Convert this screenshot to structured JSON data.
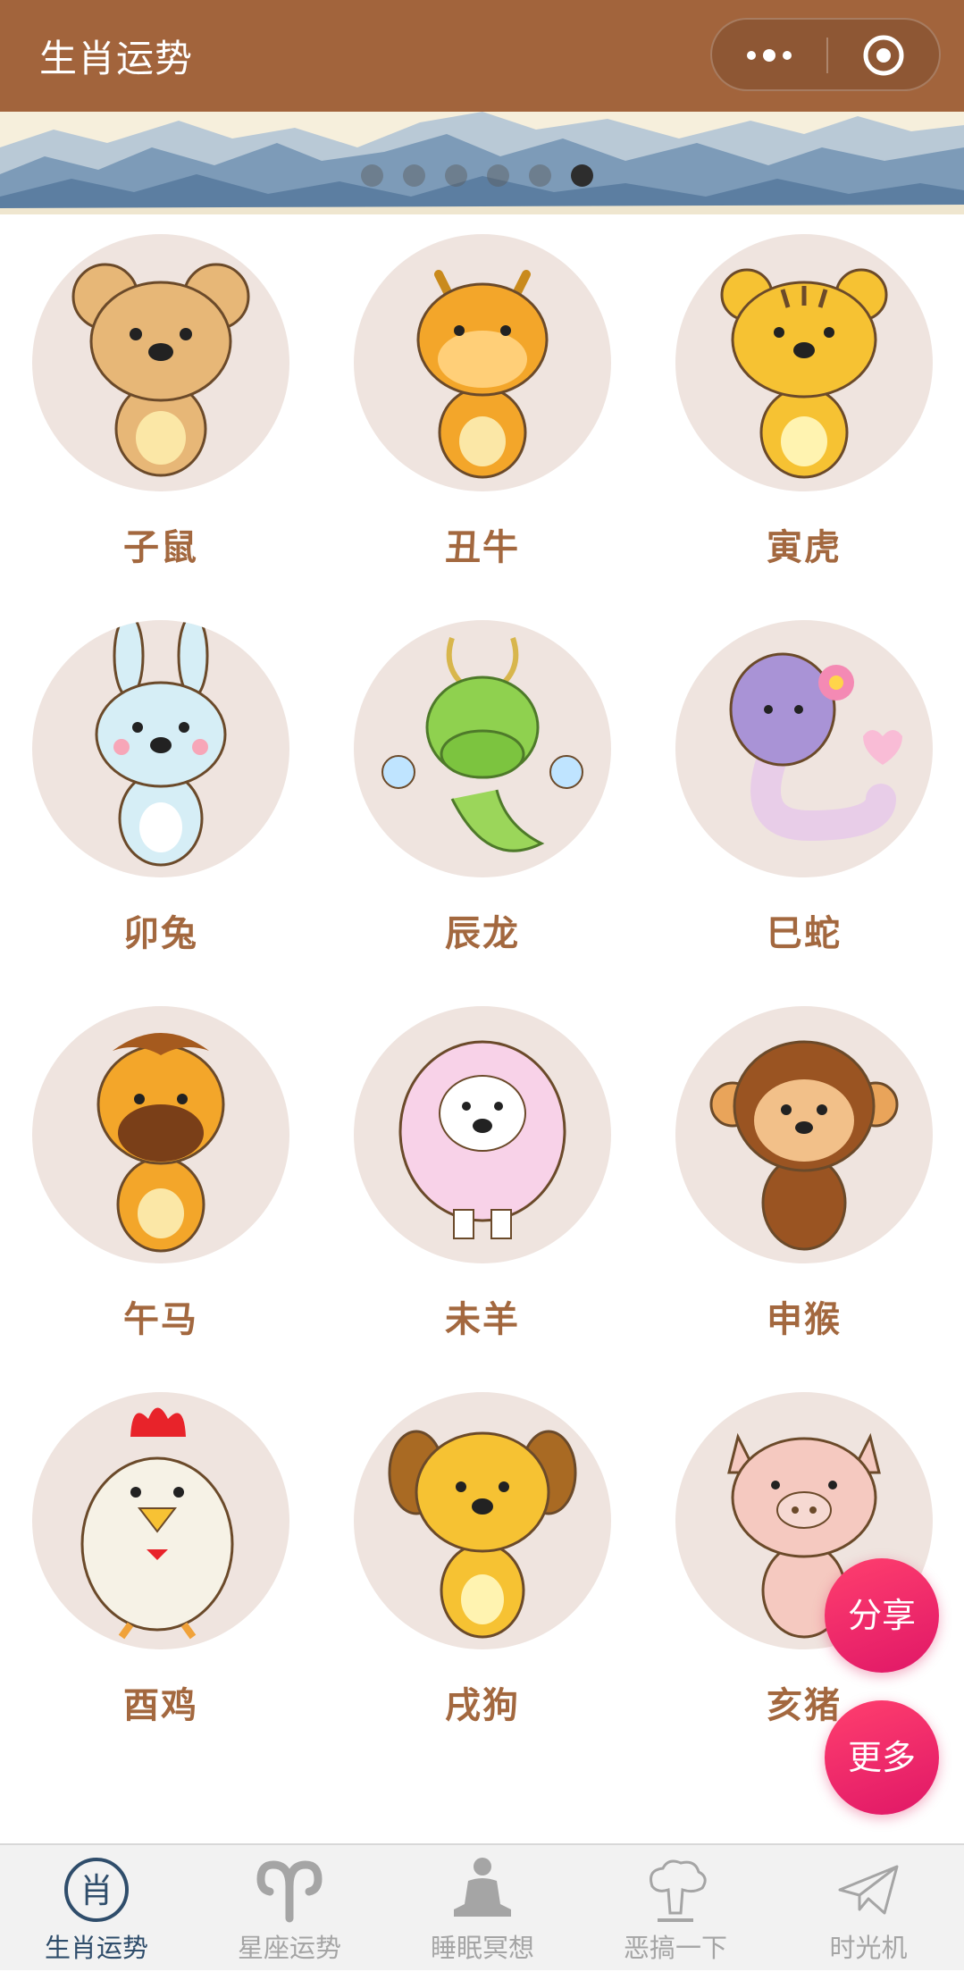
{
  "header": {
    "title": "生肖运势",
    "menu_icon": "more-dots-icon",
    "close_icon": "target-icon",
    "background": "#a2643c"
  },
  "banner": {
    "slides": 6,
    "active_slide": 6
  },
  "zodiac": [
    {
      "label": "子鼠",
      "animal": "rat"
    },
    {
      "label": "丑牛",
      "animal": "ox"
    },
    {
      "label": "寅虎",
      "animal": "tiger"
    },
    {
      "label": "卯兔",
      "animal": "rabbit"
    },
    {
      "label": "辰龙",
      "animal": "dragon"
    },
    {
      "label": "巳蛇",
      "animal": "snake"
    },
    {
      "label": "午马",
      "animal": "horse"
    },
    {
      "label": "未羊",
      "animal": "sheep"
    },
    {
      "label": "申猴",
      "animal": "monkey"
    },
    {
      "label": "酉鸡",
      "animal": "rooster"
    },
    {
      "label": "戌狗",
      "animal": "dog"
    },
    {
      "label": "亥猪",
      "animal": "pig"
    }
  ],
  "fab": {
    "share": "分享",
    "more": "更多",
    "color": "#ee2a6a"
  },
  "tabs": [
    {
      "label": "生肖运势",
      "icon": "zodiac-icon",
      "active": true
    },
    {
      "label": "星座运势",
      "icon": "aries-icon",
      "active": false
    },
    {
      "label": "睡眠冥想",
      "icon": "meditation-icon",
      "active": false
    },
    {
      "label": "恶搞一下",
      "icon": "explosion-icon",
      "active": false
    },
    {
      "label": "时光机",
      "icon": "paper-plane-icon",
      "active": false
    }
  ],
  "colors": {
    "label": "#a3683f",
    "circle": "#efe4df",
    "tab_active": "#2f4d6b",
    "tab_inactive": "#a5a5a5"
  }
}
